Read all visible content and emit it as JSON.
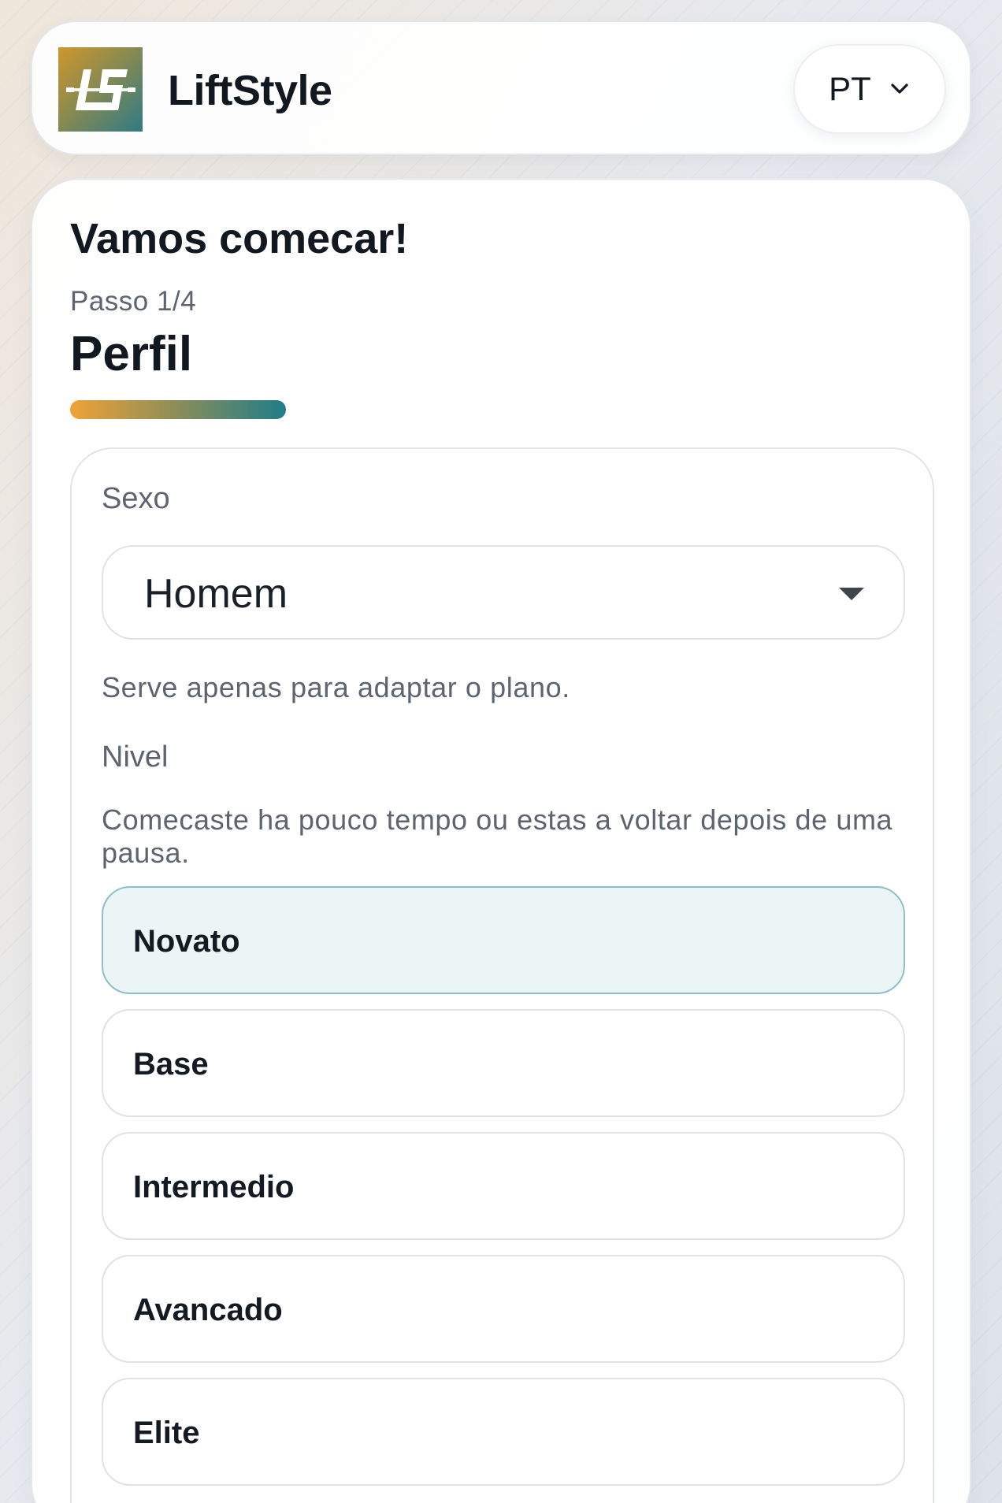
{
  "header": {
    "brand": "LiftStyle",
    "language": "PT"
  },
  "card": {
    "title": "Vamos comecar!",
    "step_label": "Passo 1/4",
    "step_title": "Perfil",
    "progress": 0.25
  },
  "form": {
    "sex": {
      "label": "Sexo",
      "value": "Homem",
      "helper": "Serve apenas para adaptar o plano."
    },
    "level": {
      "label": "Nivel",
      "helper": "Comecaste ha pouco tempo ou estas a voltar depois de uma pausa.",
      "options": [
        {
          "label": "Novato",
          "selected": true
        },
        {
          "label": "Base",
          "selected": false
        },
        {
          "label": "Intermedio",
          "selected": false
        },
        {
          "label": "Avancado",
          "selected": false
        },
        {
          "label": "Elite",
          "selected": false
        }
      ]
    }
  },
  "colors": {
    "accent_start": "#f0a236",
    "accent_end": "#1f7d8a",
    "selected_bg": "#ecf5f6",
    "selected_border": "#8fbec6"
  },
  "icons": {
    "logo": "liftstyle-logo-icon",
    "language_dropdown": "chevron-down-icon",
    "sex_dropdown": "caret-down-icon"
  }
}
